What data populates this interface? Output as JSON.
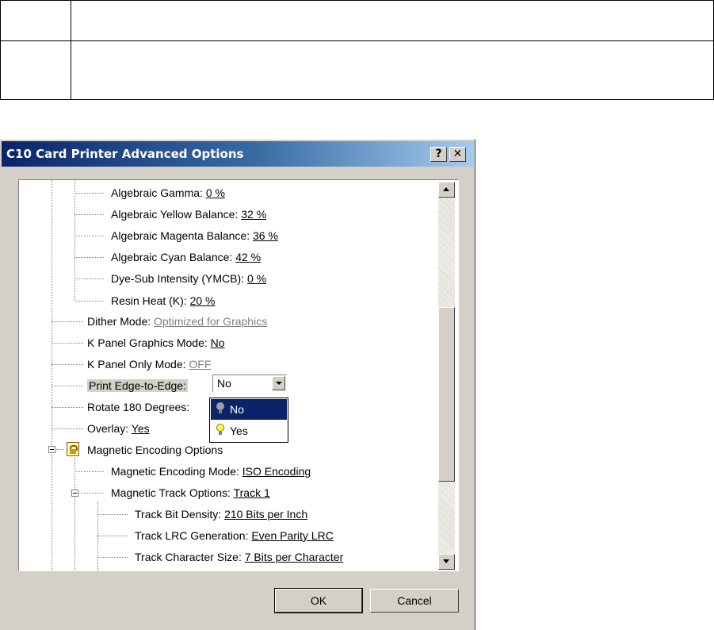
{
  "dialog": {
    "title": "C10 Card Printer Advanced Options",
    "help_label": "?",
    "close_label": "✕"
  },
  "tree": {
    "rows": [
      {
        "label": "Algebraic Gamma:",
        "value": "0 %"
      },
      {
        "label": "Algebraic Yellow Balance:",
        "value": "32 %"
      },
      {
        "label": "Algebraic Magenta Balance:",
        "value": "36 %"
      },
      {
        "label": "Algebraic Cyan Balance:",
        "value": "42 %"
      },
      {
        "label": "Dye-Sub Intensity (YMCB):",
        "value": "0 %"
      },
      {
        "label": "Resin Heat (K):",
        "value": "20 %"
      },
      {
        "label": "Dither Mode:",
        "value": "Optimized for Graphics"
      },
      {
        "label": "K Panel Graphics Mode:",
        "value": "No"
      },
      {
        "label": "K Panel Only Mode:",
        "value": "OFF"
      },
      {
        "label": "Print Edge-to-Edge:",
        "value": ""
      },
      {
        "label": "Rotate 180 Degrees:",
        "value": ""
      },
      {
        "label": "Overlay:",
        "value": "Yes"
      },
      {
        "label": "Magnetic Encoding Options",
        "value": ""
      },
      {
        "label": "Magnetic Encoding Mode:",
        "value": "ISO Encoding"
      },
      {
        "label": "Magnetic Track Options:",
        "value": "Track 1"
      },
      {
        "label": "Track Bit Density:",
        "value": "210 Bits per Inch"
      },
      {
        "label": "Track LRC Generation:",
        "value": "Even Parity LRC"
      },
      {
        "label": "Track Character Size:",
        "value": "7 Bits per Character"
      }
    ]
  },
  "combo": {
    "value": "No",
    "options": [
      {
        "label": "No",
        "icon": "bulb-off-icon",
        "selected": true
      },
      {
        "label": "Yes",
        "icon": "bulb-on-icon",
        "selected": false
      }
    ]
  },
  "buttons": {
    "ok": "OK",
    "cancel": "Cancel"
  }
}
